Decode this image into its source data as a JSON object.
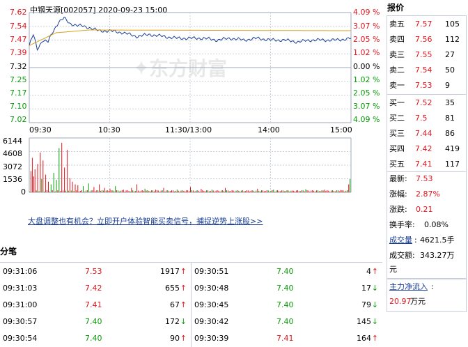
{
  "chart": {
    "title": "中钢天源[002057] 2020-09-23 15:00",
    "watermark": "东方财富",
    "price_axis": [
      "7.62",
      "7.54",
      "7.47",
      "7.39",
      "7.32",
      "7.25",
      "7.17",
      "7.10",
      "7.02"
    ],
    "pct_axis": [
      "4.09 %",
      "3.07 %",
      "2.05 %",
      "1.02 %",
      "0.00 %",
      "1.02 %",
      "2.05 %",
      "3.07 %",
      "4.09 %"
    ],
    "time_axis": [
      "09:30",
      "10:30",
      "11:30/13:00",
      "14:00",
      "15:00"
    ],
    "volume_axis": [
      "6144",
      "4608",
      "3072",
      "1536",
      "0"
    ],
    "colors": {
      "up": "#e4141d",
      "down": "#079b07",
      "price_line": "#1a3e96",
      "avg_line": "#d4a017",
      "grid": "#c7cfdc"
    }
  },
  "promo": {
    "text": "大盘调整也有机会？立即开户体验智能买卖信号，捕捉逆势上涨股>>"
  },
  "trades": {
    "title": "分笔",
    "rows": [
      {
        "left": {
          "time": "09:31:06",
          "price": "7.53",
          "vol": "1917",
          "dir": "↑"
        },
        "right": {
          "time": "09:30:51",
          "price": "7.40",
          "vol": "4",
          "dir": "↑"
        }
      },
      {
        "left": {
          "time": "09:31:03",
          "price": "7.42",
          "vol": "655",
          "dir": "↑"
        },
        "right": {
          "time": "09:30:48",
          "price": "7.40",
          "vol": "17",
          "dir": "↓"
        }
      },
      {
        "left": {
          "time": "09:31:00",
          "price": "7.41",
          "vol": "67",
          "dir": "↑"
        },
        "right": {
          "time": "09:30:45",
          "price": "7.40",
          "vol": "79",
          "dir": "↓"
        }
      },
      {
        "left": {
          "time": "09:30:57",
          "price": "7.40",
          "vol": "172",
          "dir": "↓"
        },
        "right": {
          "time": "09:30:42",
          "price": "7.40",
          "vol": "145",
          "dir": "↓"
        }
      },
      {
        "left": {
          "time": "09:30:54",
          "price": "7.40",
          "vol": "90",
          "dir": "↑"
        },
        "right": {
          "time": "09:30:39",
          "price": "7.41",
          "vol": "164",
          "dir": "↑"
        }
      }
    ]
  },
  "quote": {
    "title": "报价",
    "sells": [
      {
        "label": "卖五",
        "price": "7.57",
        "vol": "105"
      },
      {
        "label": "卖四",
        "price": "7.56",
        "vol": "112"
      },
      {
        "label": "卖三",
        "price": "7.55",
        "vol": "27"
      },
      {
        "label": "卖二",
        "price": "7.54",
        "vol": "50"
      },
      {
        "label": "卖一",
        "price": "7.53",
        "vol": "9"
      }
    ],
    "buys": [
      {
        "label": "买一",
        "price": "7.52",
        "vol": "35"
      },
      {
        "label": "买二",
        "price": "7.5",
        "vol": "81"
      },
      {
        "label": "买三",
        "price": "7.44",
        "vol": "86"
      },
      {
        "label": "买四",
        "price": "7.42",
        "vol": "419"
      },
      {
        "label": "买五",
        "price": "7.41",
        "vol": "117"
      }
    ],
    "latest_label": "最新:",
    "latest": "7.53",
    "change_pct_label": "涨幅:",
    "change_pct": "2.87%",
    "change_label": "涨跌:",
    "change": "0.21",
    "turnover_label": "换手率:",
    "turnover": "0.08%",
    "volume_label": "成交量",
    "volume_sep": ":",
    "volume": "4621.5手",
    "amount_label": "成交额:",
    "amount": "343.27万",
    "amount_unit": "元",
    "netflow_label": "主力净流入",
    "netflow_sep": ":",
    "netflow": "20.97",
    "netflow_unit": "万元"
  }
}
